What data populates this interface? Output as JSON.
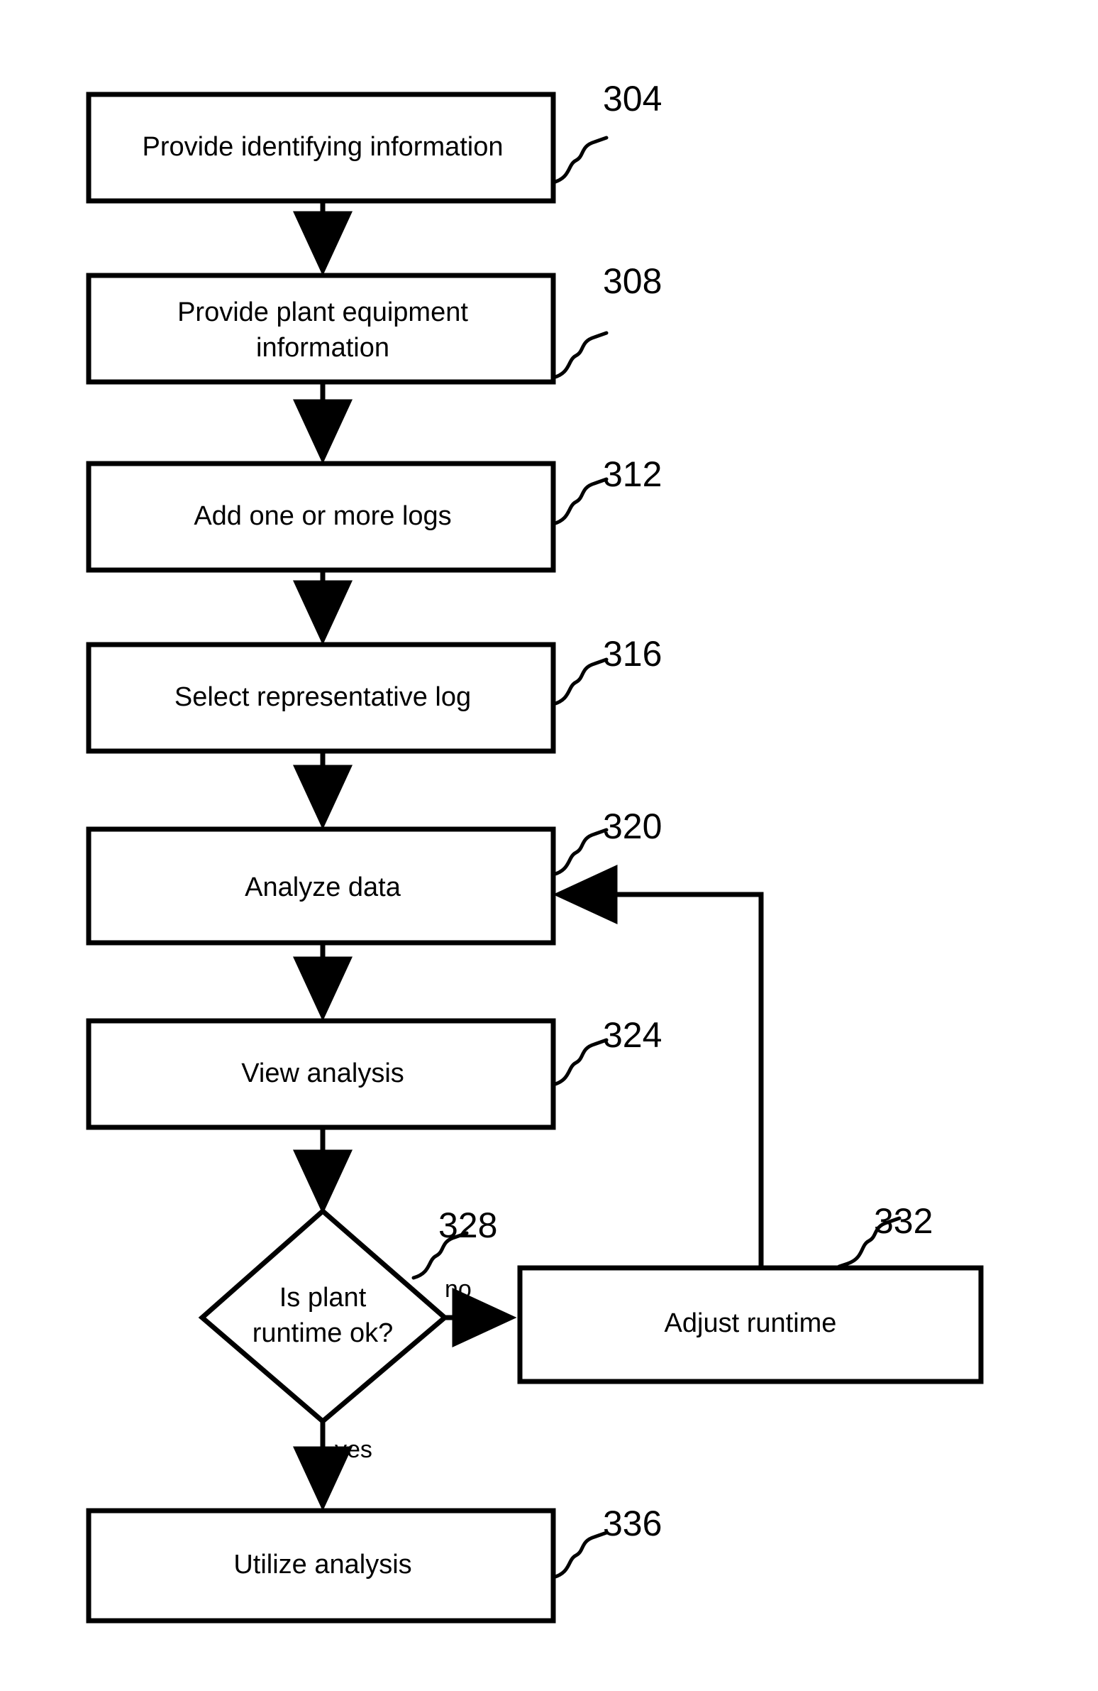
{
  "diagram": {
    "type": "flowchart",
    "title": "",
    "nodes": [
      {
        "id": "n304",
        "shape": "rectangle",
        "label_lines": [
          "Provide identifying information"
        ],
        "ref": "304"
      },
      {
        "id": "n308",
        "shape": "rectangle",
        "label_lines": [
          "Provide plant equipment",
          "information"
        ],
        "ref": "308"
      },
      {
        "id": "n312",
        "shape": "rectangle",
        "label_lines": [
          "Add one or more logs"
        ],
        "ref": "312"
      },
      {
        "id": "n316",
        "shape": "rectangle",
        "label_lines": [
          "Select representative log"
        ],
        "ref": "316"
      },
      {
        "id": "n320",
        "shape": "rectangle",
        "label_lines": [
          "Analyze data"
        ],
        "ref": "320"
      },
      {
        "id": "n324",
        "shape": "rectangle",
        "label_lines": [
          "View analysis"
        ],
        "ref": "324"
      },
      {
        "id": "n328",
        "shape": "diamond",
        "label_lines": [
          "Is plant",
          "runtime ok?"
        ],
        "ref": "328"
      },
      {
        "id": "n332",
        "shape": "rectangle",
        "label_lines": [
          "Adjust runtime"
        ],
        "ref": "332"
      },
      {
        "id": "n336",
        "shape": "rectangle",
        "label_lines": [
          "Utilize analysis"
        ],
        "ref": "336"
      }
    ],
    "edges": [
      {
        "from": "n304",
        "to": "n308",
        "label": ""
      },
      {
        "from": "n308",
        "to": "n312",
        "label": ""
      },
      {
        "from": "n312",
        "to": "n316",
        "label": ""
      },
      {
        "from": "n316",
        "to": "n320",
        "label": ""
      },
      {
        "from": "n320",
        "to": "n324",
        "label": ""
      },
      {
        "from": "n324",
        "to": "n328",
        "label": ""
      },
      {
        "from": "n328",
        "to": "n332",
        "label": "no"
      },
      {
        "from": "n328",
        "to": "n336",
        "label": "yes"
      },
      {
        "from": "n332",
        "to": "n320",
        "label": ""
      }
    ],
    "edge_labels": {
      "no": "no",
      "yes": "yes"
    },
    "colors": {
      "stroke": "#000000",
      "fill": "#ffffff",
      "text": "#000000"
    }
  }
}
